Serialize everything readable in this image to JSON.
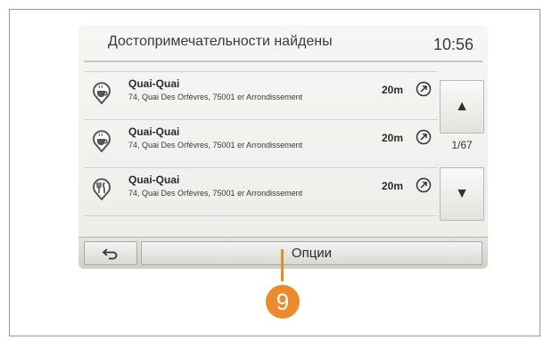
{
  "header": {
    "title": "Достопримечательности найдены",
    "clock": "10:56"
  },
  "results": [
    {
      "name": "Quai-Quai",
      "address": "74, Quai Des Orfèvres, 75001 er Arrondissement",
      "distance": "20m",
      "icon": "cafe-icon"
    },
    {
      "name": "Quai-Quai",
      "address": "74, Quai Des Orfèvres, 75001 er Arrondissement",
      "distance": "20m",
      "icon": "cafe-icon"
    },
    {
      "name": "Quai-Quai",
      "address": "74, Quai Des Orfèvres, 75001 er Arrondissement",
      "distance": "20m",
      "icon": "restaurant-icon"
    }
  ],
  "pagination": {
    "indicator": "1/67",
    "up_icon": "▲",
    "down_icon": "▼"
  },
  "bottom_bar": {
    "back_icon": "back-arrow-icon",
    "options_label": "Опции"
  },
  "callout": {
    "number": "9",
    "color": "#ec8b2b"
  }
}
